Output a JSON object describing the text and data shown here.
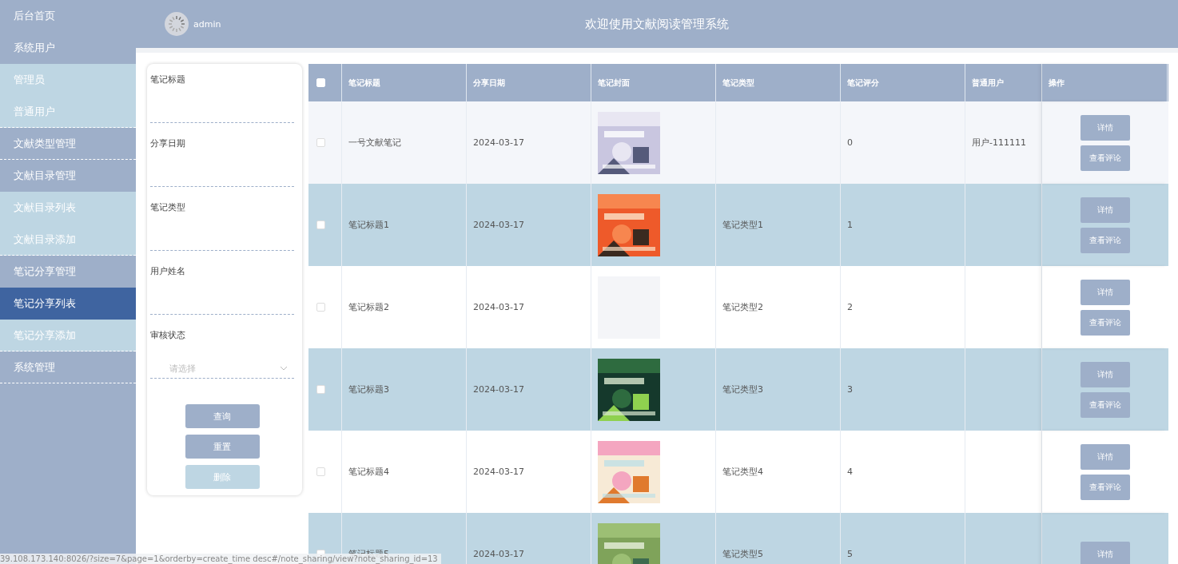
{
  "sidebar": {
    "items": [
      {
        "label": "后台首页",
        "kind": "top",
        "selected": false,
        "divider": false
      },
      {
        "label": "系统用户",
        "kind": "top",
        "selected": false,
        "divider": false
      },
      {
        "label": "管理员",
        "kind": "child",
        "selected": false,
        "divider": false
      },
      {
        "label": "普通用户",
        "kind": "child",
        "selected": false,
        "divider": true
      },
      {
        "label": "文献类型管理",
        "kind": "top",
        "selected": false,
        "divider": true
      },
      {
        "label": "文献目录管理",
        "kind": "top",
        "selected": false,
        "divider": false
      },
      {
        "label": "文献目录列表",
        "kind": "child",
        "selected": false,
        "divider": false
      },
      {
        "label": "文献目录添加",
        "kind": "child",
        "selected": false,
        "divider": true
      },
      {
        "label": "笔记分享管理",
        "kind": "top",
        "selected": false,
        "divider": false
      },
      {
        "label": "笔记分享列表",
        "kind": "child",
        "selected": true,
        "divider": false
      },
      {
        "label": "笔记分享添加",
        "kind": "child",
        "selected": false,
        "divider": true
      },
      {
        "label": "系统管理",
        "kind": "top",
        "selected": false,
        "divider": true
      }
    ]
  },
  "header": {
    "user": "admin",
    "title": "欢迎使用文献阅读管理系统"
  },
  "filters": {
    "fields": [
      {
        "label": "笔记标题",
        "kind": "input"
      },
      {
        "label": "分享日期",
        "kind": "input"
      },
      {
        "label": "笔记类型",
        "kind": "input"
      },
      {
        "label": "用户姓名",
        "kind": "input"
      },
      {
        "label": "审核状态",
        "kind": "select",
        "placeholder": "请选择"
      }
    ],
    "buttons": [
      {
        "label": "查询",
        "disabled": false
      },
      {
        "label": "重置",
        "disabled": false
      },
      {
        "label": "删除",
        "disabled": true
      }
    ]
  },
  "table": {
    "columns": [
      "笔记标题",
      "分享日期",
      "笔记封面",
      "笔记类型",
      "笔记评分",
      "普通用户",
      "操作"
    ],
    "select_all": {
      "checked": false
    },
    "rows": [
      {
        "checked": false,
        "title": "一号文献笔记",
        "date": "2024-03-17",
        "cover": {
          "kind": "picture"
        },
        "type": "",
        "score": "0",
        "user": "用户-111111",
        "actions": [
          "详情",
          "查看评论"
        ]
      },
      {
        "checked": false,
        "title": "笔记标题1",
        "date": "2024-03-17",
        "cover": {
          "kind": "picture"
        },
        "type": "笔记类型1",
        "score": "1",
        "user": "",
        "actions": [
          "详情",
          "查看评论"
        ]
      },
      {
        "checked": false,
        "title": "笔记标题2",
        "date": "2024-03-17",
        "cover": {
          "kind": "empty"
        },
        "type": "笔记类型2",
        "score": "2",
        "user": "",
        "actions": [
          "详情",
          "查看评论"
        ]
      },
      {
        "checked": false,
        "title": "笔记标题3",
        "date": "2024-03-17",
        "cover": {
          "kind": "picture"
        },
        "type": "笔记类型3",
        "score": "3",
        "user": "",
        "actions": [
          "详情",
          "查看评论"
        ]
      },
      {
        "checked": false,
        "title": "笔记标题4",
        "date": "2024-03-17",
        "cover": {
          "kind": "picture"
        },
        "type": "笔记类型4",
        "score": "4",
        "user": "",
        "actions": [
          "详情",
          "查看评论"
        ]
      },
      {
        "checked": false,
        "title": "笔记标题5",
        "date": "2024-03-17",
        "cover": {
          "kind": "picture"
        },
        "type": "笔记类型5",
        "score": "5",
        "user": "",
        "actions": [
          "详情"
        ]
      }
    ]
  },
  "status_bar": {
    "url": "39.108.173.140:8026/?size=7&page=1&orderby=create_time desc#/note_sharing/view?note_sharing_id=13"
  }
}
